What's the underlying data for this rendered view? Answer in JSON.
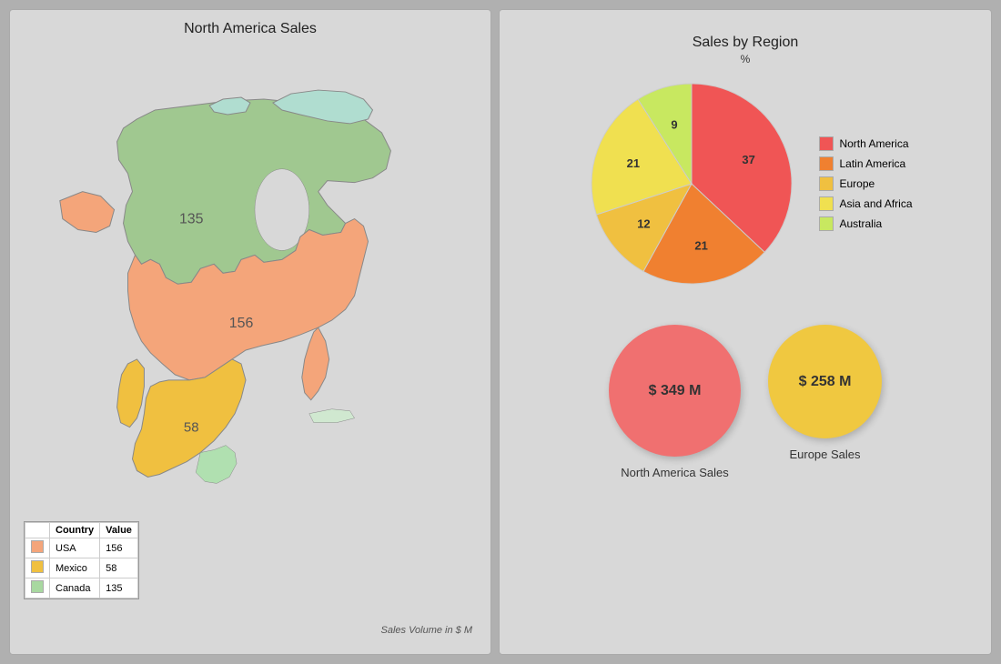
{
  "left_panel": {
    "title": "North America Sales",
    "subtitle": "Sales Volume in $ M",
    "legend": {
      "headers": [
        "Country",
        "Value"
      ],
      "rows": [
        {
          "color": "#f4a57a",
          "country": "USA",
          "value": "156"
        },
        {
          "color": "#f0c040",
          "country": "Mexico",
          "value": "58"
        },
        {
          "color": "#a8d8a0",
          "country": "Canada",
          "value": "135"
        }
      ]
    },
    "map": {
      "canada_label": "135",
      "usa_label": "156",
      "mexico_label": "58"
    }
  },
  "right_panel": {
    "title": "Sales by Region",
    "subtitle": "%",
    "pie": {
      "segments": [
        {
          "label": "North America",
          "value": 37,
          "color": "#f05555",
          "startAngle": 0
        },
        {
          "label": "Latin America",
          "value": 21,
          "color": "#f08030",
          "startAngle": 133
        },
        {
          "label": "Europe",
          "value": 12,
          "color": "#f0c040",
          "startAngle": 209
        },
        {
          "label": "Asia and Africa",
          "value": 21,
          "color": "#f0e050",
          "startAngle": 252
        },
        {
          "label": "Australia",
          "value": 9,
          "color": "#c8e860",
          "startAngle": 328
        }
      ]
    },
    "bubbles": [
      {
        "label": "North America Sales",
        "value": "$ 349 M",
        "color": "#f07070",
        "size": 140
      },
      {
        "label": "Europe Sales",
        "value": "$ 258 M",
        "color": "#f0c840",
        "size": 120
      }
    ]
  }
}
